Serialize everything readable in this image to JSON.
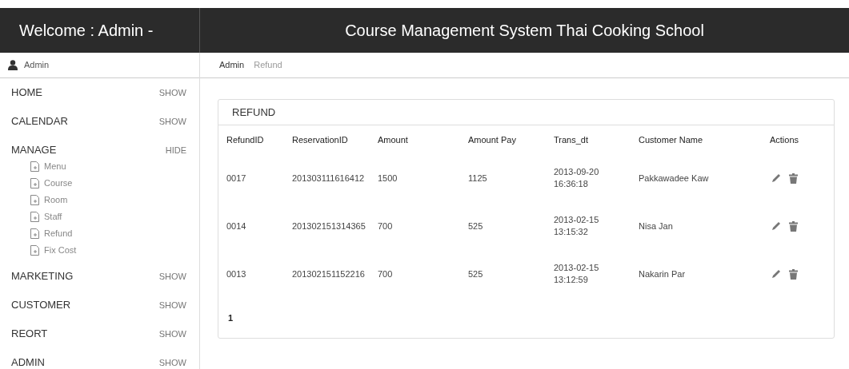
{
  "header": {
    "welcome": "Welcome : Admin -",
    "title": "Course Management System Thai Cooking School"
  },
  "user": {
    "name": "Admin"
  },
  "breadcrumb": [
    {
      "label": "Admin",
      "selected": false
    },
    {
      "label": "Refund",
      "selected": true
    }
  ],
  "sidebar": {
    "sections": [
      {
        "label": "HOME",
        "toggle": "SHOW"
      },
      {
        "label": "CALENDAR",
        "toggle": "SHOW"
      },
      {
        "label": "MANAGE",
        "toggle": "HIDE",
        "children": [
          "Menu",
          "Course",
          "Room",
          "Staff",
          "Refund",
          "Fix Cost"
        ]
      },
      {
        "label": "MARKETING",
        "toggle": "SHOW"
      },
      {
        "label": "CUSTOMER",
        "toggle": "SHOW"
      },
      {
        "label": "REORT",
        "toggle": "SHOW"
      },
      {
        "label": "ADMIN",
        "toggle": "SHOW"
      }
    ]
  },
  "panel": {
    "title": "REFUND",
    "table": {
      "columns": [
        "RefundID",
        "ReservationID",
        "Amount",
        "Amount Pay",
        "Trans_dt",
        "Customer Name",
        "Actions"
      ],
      "rows": [
        {
          "refund_id": "0017",
          "reservation_id": "201303111616412",
          "amount": "1500",
          "amount_pay": "1125",
          "trans_date": "2013-09-20",
          "trans_time": "16:36:18",
          "customer": "Pakkawadee Kaw"
        },
        {
          "refund_id": "0014",
          "reservation_id": "201302151314365",
          "amount": "700",
          "amount_pay": "525",
          "trans_date": "2013-02-15",
          "trans_time": "13:15:32",
          "customer": "Nisa Jan"
        },
        {
          "refund_id": "0013",
          "reservation_id": "201302151152216",
          "amount": "700",
          "amount_pay": "525",
          "trans_date": "2013-02-15",
          "trans_time": "13:12:59",
          "customer": "Nakarin Par"
        }
      ]
    },
    "pages": [
      {
        "label": "1",
        "selected": true
      }
    ]
  }
}
